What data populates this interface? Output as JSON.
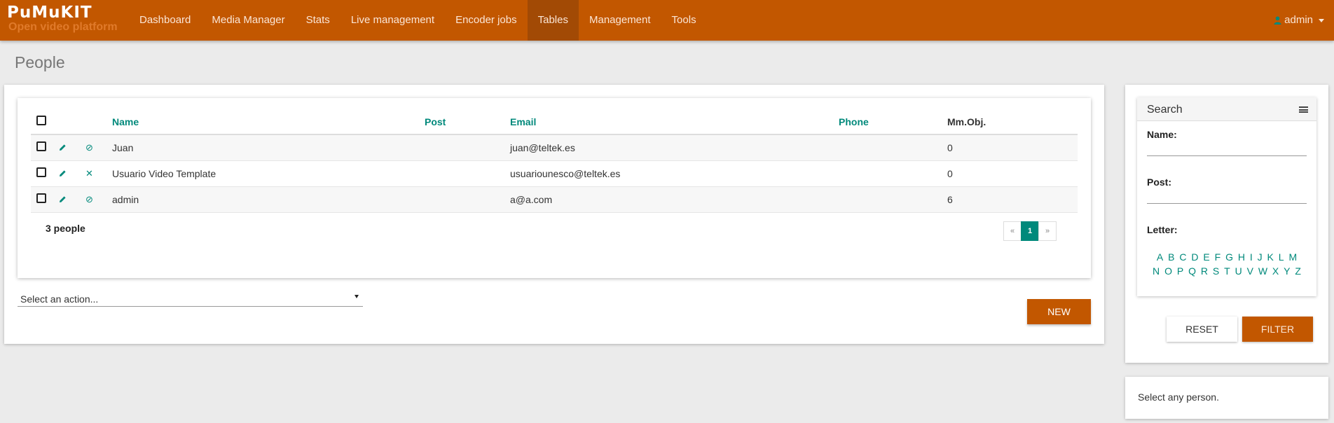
{
  "navbar": {
    "logo_text": "PuMuKIT",
    "logo_subtitle": "Open video platform",
    "items": [
      {
        "label": "Dashboard",
        "active": false
      },
      {
        "label": "Media Manager",
        "active": false
      },
      {
        "label": "Stats",
        "active": false
      },
      {
        "label": "Live management",
        "active": false
      },
      {
        "label": "Encoder jobs",
        "active": false
      },
      {
        "label": "Tables",
        "active": true
      },
      {
        "label": "Management",
        "active": false
      },
      {
        "label": "Tools",
        "active": false
      }
    ],
    "user": "admin",
    "colors": {
      "bar": "#c25700",
      "active": "#a24a05"
    }
  },
  "page": {
    "title": "People"
  },
  "table": {
    "columns": [
      "Name",
      "Post",
      "Email",
      "Phone",
      "Mm.Obj."
    ],
    "rows": [
      {
        "name": "Juan",
        "post": "",
        "email": "juan@teltek.es",
        "phone": "",
        "mmobj": "0",
        "action_icon": "ban-icon",
        "action_glyph": "⊘"
      },
      {
        "name": "Usuario Video Template",
        "post": "",
        "email": "usuariounesco@teltek.es",
        "phone": "",
        "mmobj": "0",
        "action_icon": "delete-x-icon",
        "action_glyph": "✕"
      },
      {
        "name": "admin",
        "post": "",
        "email": "a@a.com",
        "phone": "",
        "mmobj": "6",
        "action_icon": "ban-icon",
        "action_glyph": "⊘"
      }
    ],
    "count_text": "3 people",
    "pagination": {
      "prev": "«",
      "current": "1",
      "next": "»"
    },
    "accent_color": "#00897b"
  },
  "actions": {
    "select_placeholder": "Select an action...",
    "new_label": "NEW"
  },
  "search": {
    "title": "Search",
    "name_label": "Name:",
    "post_label": "Post:",
    "letter_label": "Letter:",
    "letters_row1": [
      "A",
      "B",
      "C",
      "D",
      "E",
      "F",
      "G",
      "H",
      "I",
      "J",
      "K",
      "L",
      "M"
    ],
    "letters_row2": [
      "N",
      "O",
      "P",
      "Q",
      "R",
      "S",
      "T",
      "U",
      "V",
      "W",
      "X",
      "Y",
      "Z"
    ],
    "reset_label": "RESET",
    "filter_label": "FILTER"
  },
  "info": {
    "text": "Select any person."
  }
}
